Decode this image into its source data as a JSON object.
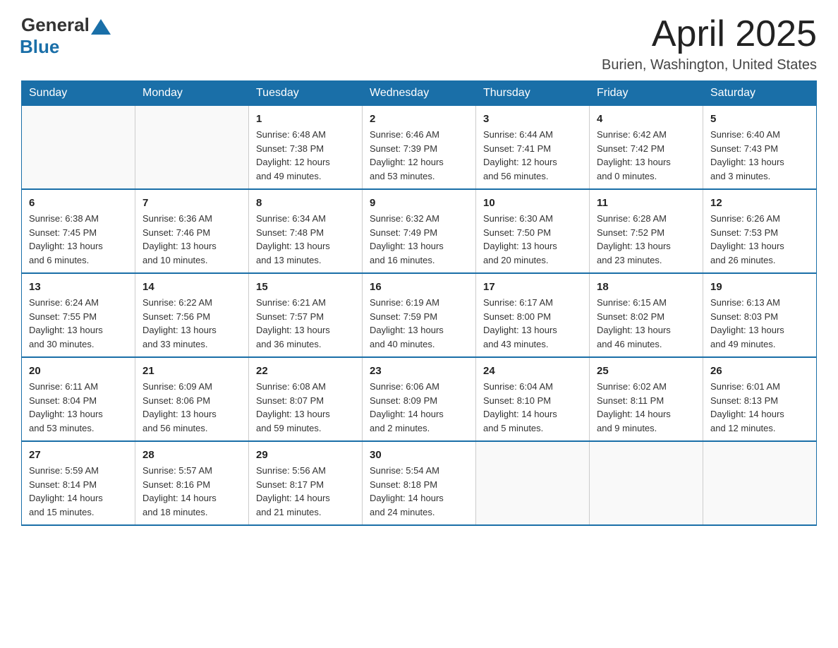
{
  "header": {
    "logo_general": "General",
    "logo_blue": "Blue",
    "month_title": "April 2025",
    "location": "Burien, Washington, United States"
  },
  "weekdays": [
    "Sunday",
    "Monday",
    "Tuesday",
    "Wednesday",
    "Thursday",
    "Friday",
    "Saturday"
  ],
  "weeks": [
    [
      {
        "day": "",
        "info": ""
      },
      {
        "day": "",
        "info": ""
      },
      {
        "day": "1",
        "info": "Sunrise: 6:48 AM\nSunset: 7:38 PM\nDaylight: 12 hours\nand 49 minutes."
      },
      {
        "day": "2",
        "info": "Sunrise: 6:46 AM\nSunset: 7:39 PM\nDaylight: 12 hours\nand 53 minutes."
      },
      {
        "day": "3",
        "info": "Sunrise: 6:44 AM\nSunset: 7:41 PM\nDaylight: 12 hours\nand 56 minutes."
      },
      {
        "day": "4",
        "info": "Sunrise: 6:42 AM\nSunset: 7:42 PM\nDaylight: 13 hours\nand 0 minutes."
      },
      {
        "day": "5",
        "info": "Sunrise: 6:40 AM\nSunset: 7:43 PM\nDaylight: 13 hours\nand 3 minutes."
      }
    ],
    [
      {
        "day": "6",
        "info": "Sunrise: 6:38 AM\nSunset: 7:45 PM\nDaylight: 13 hours\nand 6 minutes."
      },
      {
        "day": "7",
        "info": "Sunrise: 6:36 AM\nSunset: 7:46 PM\nDaylight: 13 hours\nand 10 minutes."
      },
      {
        "day": "8",
        "info": "Sunrise: 6:34 AM\nSunset: 7:48 PM\nDaylight: 13 hours\nand 13 minutes."
      },
      {
        "day": "9",
        "info": "Sunrise: 6:32 AM\nSunset: 7:49 PM\nDaylight: 13 hours\nand 16 minutes."
      },
      {
        "day": "10",
        "info": "Sunrise: 6:30 AM\nSunset: 7:50 PM\nDaylight: 13 hours\nand 20 minutes."
      },
      {
        "day": "11",
        "info": "Sunrise: 6:28 AM\nSunset: 7:52 PM\nDaylight: 13 hours\nand 23 minutes."
      },
      {
        "day": "12",
        "info": "Sunrise: 6:26 AM\nSunset: 7:53 PM\nDaylight: 13 hours\nand 26 minutes."
      }
    ],
    [
      {
        "day": "13",
        "info": "Sunrise: 6:24 AM\nSunset: 7:55 PM\nDaylight: 13 hours\nand 30 minutes."
      },
      {
        "day": "14",
        "info": "Sunrise: 6:22 AM\nSunset: 7:56 PM\nDaylight: 13 hours\nand 33 minutes."
      },
      {
        "day": "15",
        "info": "Sunrise: 6:21 AM\nSunset: 7:57 PM\nDaylight: 13 hours\nand 36 minutes."
      },
      {
        "day": "16",
        "info": "Sunrise: 6:19 AM\nSunset: 7:59 PM\nDaylight: 13 hours\nand 40 minutes."
      },
      {
        "day": "17",
        "info": "Sunrise: 6:17 AM\nSunset: 8:00 PM\nDaylight: 13 hours\nand 43 minutes."
      },
      {
        "day": "18",
        "info": "Sunrise: 6:15 AM\nSunset: 8:02 PM\nDaylight: 13 hours\nand 46 minutes."
      },
      {
        "day": "19",
        "info": "Sunrise: 6:13 AM\nSunset: 8:03 PM\nDaylight: 13 hours\nand 49 minutes."
      }
    ],
    [
      {
        "day": "20",
        "info": "Sunrise: 6:11 AM\nSunset: 8:04 PM\nDaylight: 13 hours\nand 53 minutes."
      },
      {
        "day": "21",
        "info": "Sunrise: 6:09 AM\nSunset: 8:06 PM\nDaylight: 13 hours\nand 56 minutes."
      },
      {
        "day": "22",
        "info": "Sunrise: 6:08 AM\nSunset: 8:07 PM\nDaylight: 13 hours\nand 59 minutes."
      },
      {
        "day": "23",
        "info": "Sunrise: 6:06 AM\nSunset: 8:09 PM\nDaylight: 14 hours\nand 2 minutes."
      },
      {
        "day": "24",
        "info": "Sunrise: 6:04 AM\nSunset: 8:10 PM\nDaylight: 14 hours\nand 5 minutes."
      },
      {
        "day": "25",
        "info": "Sunrise: 6:02 AM\nSunset: 8:11 PM\nDaylight: 14 hours\nand 9 minutes."
      },
      {
        "day": "26",
        "info": "Sunrise: 6:01 AM\nSunset: 8:13 PM\nDaylight: 14 hours\nand 12 minutes."
      }
    ],
    [
      {
        "day": "27",
        "info": "Sunrise: 5:59 AM\nSunset: 8:14 PM\nDaylight: 14 hours\nand 15 minutes."
      },
      {
        "day": "28",
        "info": "Sunrise: 5:57 AM\nSunset: 8:16 PM\nDaylight: 14 hours\nand 18 minutes."
      },
      {
        "day": "29",
        "info": "Sunrise: 5:56 AM\nSunset: 8:17 PM\nDaylight: 14 hours\nand 21 minutes."
      },
      {
        "day": "30",
        "info": "Sunrise: 5:54 AM\nSunset: 8:18 PM\nDaylight: 14 hours\nand 24 minutes."
      },
      {
        "day": "",
        "info": ""
      },
      {
        "day": "",
        "info": ""
      },
      {
        "day": "",
        "info": ""
      }
    ]
  ]
}
